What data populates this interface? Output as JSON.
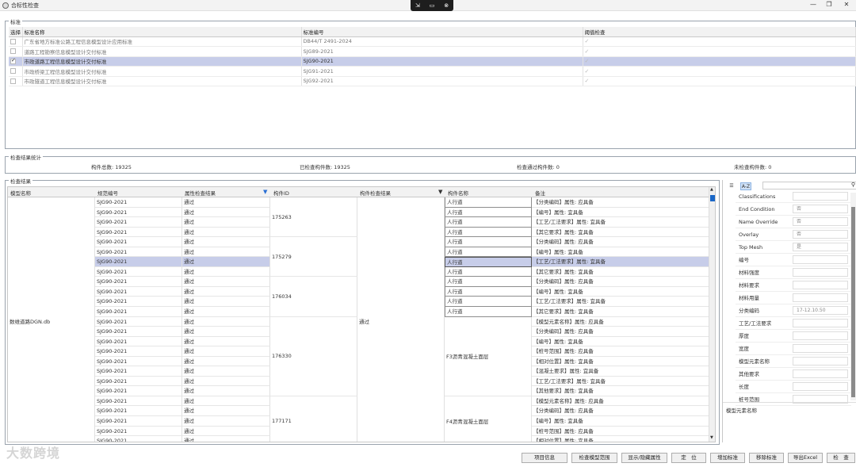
{
  "window": {
    "title": "合标性检查",
    "minimize": "—",
    "maximize": "❐",
    "close": "✕"
  },
  "floatbar": {
    "icons": [
      "pin-icon",
      "screen-icon",
      "close-icon"
    ],
    "glyphs": [
      "⇲",
      "▭",
      "⊗"
    ]
  },
  "standards": {
    "group_label": "标准",
    "headers": {
      "select": "选择",
      "name": "标准名称",
      "code": "标准编号",
      "threshold": "阈值检查"
    },
    "rows": [
      {
        "checked": false,
        "name": "广东省地方标准公路工程信息模型设计应用标准",
        "code": "DB44/T 2491-2024",
        "threshold": "✓",
        "selected": false
      },
      {
        "checked": false,
        "name": "道路工程勘察信息模型设计交付标准",
        "code": "SJG89-2021",
        "threshold": "✓",
        "selected": false
      },
      {
        "checked": true,
        "name": "市政道路工程信息模型设计交付标准",
        "code": "SJG90-2021",
        "threshold": "✓",
        "selected": true
      },
      {
        "checked": false,
        "name": "市政桥梁工程信息模型设计交付标准",
        "code": "SJG91-2021",
        "threshold": "✓",
        "selected": false
      },
      {
        "checked": false,
        "name": "市政隧道工程信息模型设计交付标准",
        "code": "SJG92-2021",
        "threshold": "✓",
        "selected": false
      }
    ]
  },
  "stats": {
    "group_label": "检查结果统计",
    "total": "构件总数: 19325",
    "checked": "已检查构件数: 19325",
    "passed": "检查通过构件数: 0",
    "unchecked": "未检查构件数: 0"
  },
  "results": {
    "group_label": "检查结果",
    "headers": {
      "model": "模型名称",
      "code": "规范编号",
      "attr_result": "属性检查结果",
      "component_id": "构件ID",
      "component_result": "构件检查结果",
      "component_name": "构件名称",
      "remark": "备注"
    },
    "model_name": "数维道路DGN.db",
    "component_result": "通过",
    "codes": [
      "SJG90-2021",
      "SJG90-2021",
      "SJG90-2021",
      "SJG90-2021",
      "SJG90-2021",
      "SJG90-2021",
      "SJG90-2021",
      "SJG90-2021",
      "SJG90-2021",
      "SJG90-2021",
      "SJG90-2021",
      "SJG90-2021",
      "SJG90-2021",
      "SJG90-2021",
      "SJG90-2021",
      "SJG90-2021",
      "SJG90-2021",
      "SJG90-2021",
      "SJG90-2021",
      "SJG90-2021",
      "SJG90-2021",
      "SJG90-2021",
      "SJG90-2021",
      "SJG90-2021",
      "SJG90-2021"
    ],
    "attr_results": [
      "通过",
      "通过",
      "通过",
      "通过",
      "通过",
      "通过",
      "通过",
      "通过",
      "通过",
      "通过",
      "通过",
      "通过",
      "通过",
      "通过",
      "通过",
      "通过",
      "通过",
      "通过",
      "通过",
      "通过",
      "通过",
      "通过",
      "通过",
      "通过",
      "通过"
    ],
    "selected_row": 6,
    "component_ids": [
      "175263",
      "175279",
      "176034",
      "176330",
      "177171"
    ],
    "names_top": [
      "人行道",
      "人行道",
      "人行道",
      "人行道",
      "人行道",
      "人行道",
      "人行道",
      "人行道",
      "人行道",
      "人行道",
      "人行道",
      "人行道"
    ],
    "name_group1": "F3沥青混凝土面层",
    "name_group2": "F4沥青混凝土面层",
    "remarks": [
      "【分类编码】属性: 应具备",
      "【编号】属性: 宜具备",
      "【工艺/工法要求】属性: 宜具备",
      "【其它要求】属性: 宜具备",
      "【分类编码】属性: 应具备",
      "【编号】属性: 宜具备",
      "【工艺/工法要求】属性: 宜具备",
      "【其它要求】属性: 宜具备",
      "【分类编码】属性: 应具备",
      "【编号】属性: 宜具备",
      "【工艺/工法要求】属性: 宜具备",
      "【其它要求】属性: 宜具备",
      "【模型元素名称】属性: 应具备",
      "【分类编码】属性: 应具备",
      "【编号】属性: 宜具备",
      "【桩号范围】属性: 应具备",
      "【相对位置】属性: 宜具备",
      "【混凝土要求】属性: 宜具备",
      "【工艺/工法要求】属性: 宜具备",
      "【其他要求】属性: 宜具备",
      "【模型元素名称】属性: 应具备",
      "【分类编码】属性: 应具备",
      "【编号】属性: 宜具备",
      "【桩号范围】属性: 应具备",
      "【相对位置】属性: 宜具备"
    ]
  },
  "properties": {
    "sort_label": "A-Z",
    "rows": [
      {
        "key": "Classifications",
        "value": ""
      },
      {
        "key": "End Condition",
        "value": "否"
      },
      {
        "key": "Name Override",
        "value": "否"
      },
      {
        "key": "Overlay",
        "value": "否"
      },
      {
        "key": "Top Mesh",
        "value": "是"
      },
      {
        "key": "编号",
        "value": ""
      },
      {
        "key": "材料强度",
        "value": ""
      },
      {
        "key": "材料要求",
        "value": ""
      },
      {
        "key": "材料用量",
        "value": ""
      },
      {
        "key": "分类编码",
        "value": "17-12.10.50"
      },
      {
        "key": "工艺/工法要求",
        "value": ""
      },
      {
        "key": "厚度",
        "value": ""
      },
      {
        "key": "宽度",
        "value": ""
      },
      {
        "key": "模型元素名称",
        "value": ""
      },
      {
        "key": "其他要求",
        "value": ""
      },
      {
        "key": "长度",
        "value": ""
      },
      {
        "key": "桩号范围",
        "value": ""
      }
    ],
    "description_title": "模型元素名称"
  },
  "buttons": [
    "项目信息",
    "检查模型范围",
    "显示/隐藏属性",
    "定　位",
    "增加标准",
    "移除标准",
    "导出Excel",
    "检　查"
  ],
  "watermark": "大数跨境"
}
